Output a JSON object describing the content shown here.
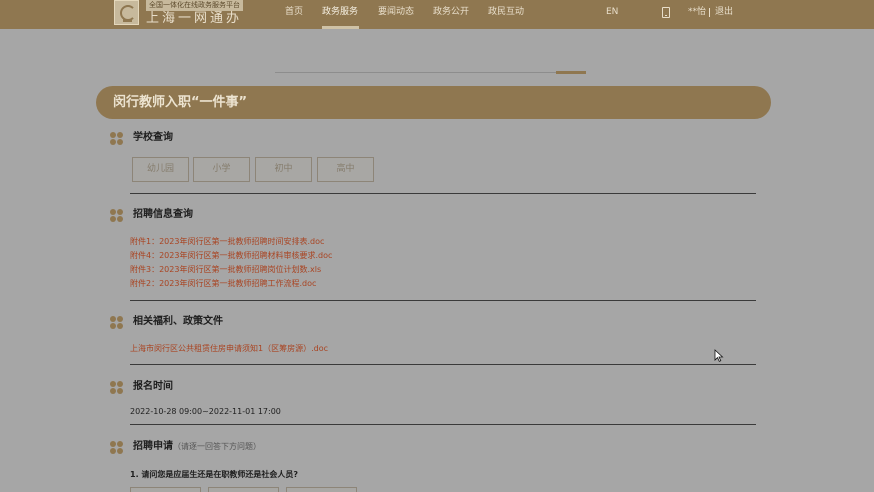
{
  "header": {
    "logo_sub": "全国一体化在线政务服务平台",
    "logo_main": "上海一网通办",
    "nav": [
      {
        "label": "首页"
      },
      {
        "label": "政务服务",
        "active": true
      },
      {
        "label": "要闻动态"
      },
      {
        "label": "政务公开"
      },
      {
        "label": "政民互动"
      }
    ],
    "lang": "EN",
    "phone_icon": "mobile-phone-icon",
    "user": "**怡",
    "separator": "|",
    "logout": "退出"
  },
  "progress": {
    "value": 1.0
  },
  "page_title": "闵行教师入职“一件事”",
  "sections": {
    "school": {
      "title": "学校查询",
      "buttons": [
        "幼儿园",
        "小学",
        "初中",
        "高中"
      ]
    },
    "recruit_info": {
      "title": "招聘信息查询",
      "files": [
        "附件1：2023年闵行区第一批教师招聘时间安排表.doc",
        "附件4：2023年闵行区第一批教师招聘材料审核要求.doc",
        "附件3：2023年闵行区第一批教师招聘岗位计划数.xls",
        "附件2：2023年闵行区第一批教师招聘工作流程.doc"
      ]
    },
    "welfare": {
      "title": "相关福利、政策文件",
      "files": [
        "上海市闵行区公共租赁住房申请须知1（区筹房源）.doc"
      ]
    },
    "signup_time": {
      "title": "报名时间",
      "value": "2022-10-28 09:00~2022-11-01 17:00"
    },
    "apply": {
      "title": "招聘申请",
      "hint": "（请逐一回答下方问题）",
      "question1": "1. 请问您是应届生还是在职教师还是社会人员?"
    }
  },
  "colors": {
    "brand": "#8f7750",
    "link": "#a94422",
    "background": "#a6a6a6"
  },
  "icons": {
    "section": "clover-icon",
    "cursor": "mouse-pointer-icon"
  }
}
